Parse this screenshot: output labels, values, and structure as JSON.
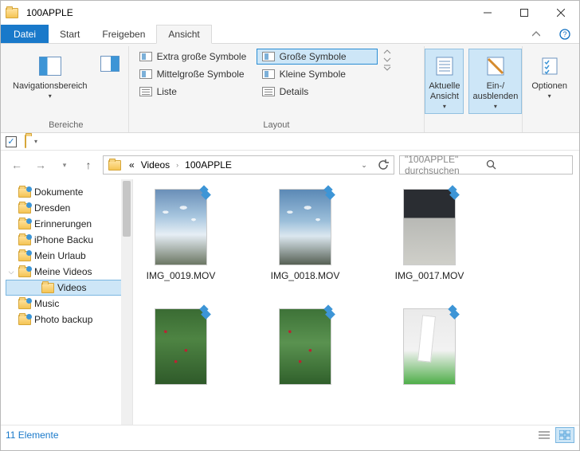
{
  "window": {
    "title": "100APPLE"
  },
  "tabs": {
    "file": "Datei",
    "items": [
      "Start",
      "Freigeben",
      "Ansicht"
    ],
    "active_index": 2
  },
  "ribbon": {
    "panes_label": "Bereiche",
    "nav_pane": "Navigationsbereich",
    "layout_label": "Layout",
    "layout_options": {
      "xl": "Extra große Symbole",
      "large": "Große Symbole",
      "medium": "Mittelgroße Symbole",
      "small": "Kleine Symbole",
      "list": "Liste",
      "details": "Details"
    },
    "current_view_label": "Aktuelle\nAnsicht",
    "show_hide_label": "Ein-/\nausblenden",
    "options_label": "Optionen"
  },
  "address": {
    "crumbs": [
      "Videos",
      "100APPLE"
    ],
    "search_placeholder": "\"100APPLE\" durchsuchen"
  },
  "tree": {
    "items": [
      {
        "label": "Dokumente",
        "pin": true
      },
      {
        "label": "Dresden",
        "pin": true
      },
      {
        "label": "Erinnerungen",
        "pin": true
      },
      {
        "label": "iPhone Backu",
        "pin": true
      },
      {
        "label": "Mein Urlaub",
        "pin": true
      },
      {
        "label": "Meine Videos",
        "pin": true,
        "expandable": true
      },
      {
        "label": "Videos",
        "sub": true,
        "selected": true
      },
      {
        "label": "Music",
        "pin": true
      },
      {
        "label": "Photo backup",
        "pin": true
      }
    ]
  },
  "files": [
    {
      "name": "IMG_0019.MOV",
      "thumb": "sky"
    },
    {
      "name": "IMG_0018.MOV",
      "thumb": "sky2"
    },
    {
      "name": "IMG_0017.MOV",
      "thumb": "laptop"
    },
    {
      "name": "",
      "thumb": "bush"
    },
    {
      "name": "",
      "thumb": "bush2"
    },
    {
      "name": "",
      "thumb": "desk"
    }
  ],
  "status": {
    "count_text": "11 Elemente"
  }
}
